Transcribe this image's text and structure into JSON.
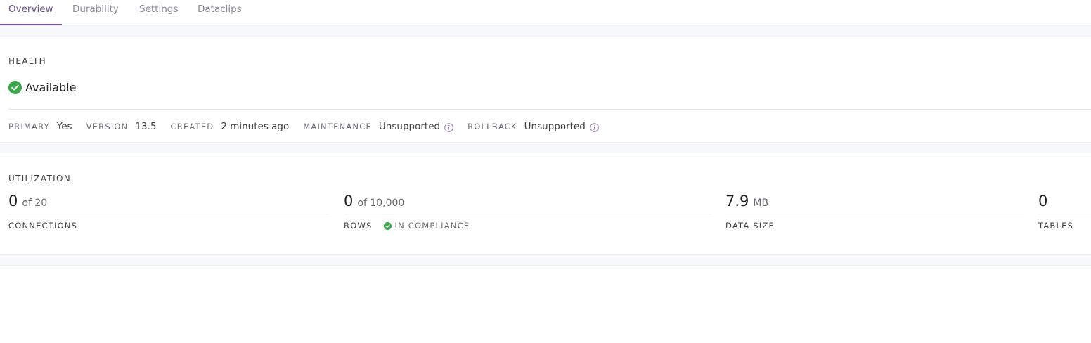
{
  "tabs": [
    {
      "label": "Overview",
      "active": true
    },
    {
      "label": "Durability",
      "active": false
    },
    {
      "label": "Settings",
      "active": false
    },
    {
      "label": "Dataclips",
      "active": false
    }
  ],
  "health": {
    "heading": "HEALTH",
    "status": "Available",
    "status_color": "#3aa84a"
  },
  "meta": {
    "primary_label": "PRIMARY",
    "primary_value": "Yes",
    "version_label": "VERSION",
    "version_value": "13.5",
    "created_label": "CREATED",
    "created_value": "2 minutes ago",
    "maintenance_label": "MAINTENANCE",
    "maintenance_value": "Unsupported",
    "rollback_label": "ROLLBACK",
    "rollback_value": "Unsupported"
  },
  "utilization": {
    "heading": "UTILIZATION",
    "connections": {
      "value": "0",
      "suffix": "of 20",
      "label": "CONNECTIONS"
    },
    "rows": {
      "value": "0",
      "suffix": "of 10,000",
      "label": "ROWS",
      "compliance": "IN COMPLIANCE"
    },
    "data_size": {
      "value": "7.9",
      "suffix": "MB",
      "label": "DATA SIZE"
    },
    "tables": {
      "value": "0",
      "label": "TABLES"
    }
  },
  "colors": {
    "accent": "#79589f",
    "success": "#3aa84a",
    "info_icon": "#9a7fc0"
  }
}
